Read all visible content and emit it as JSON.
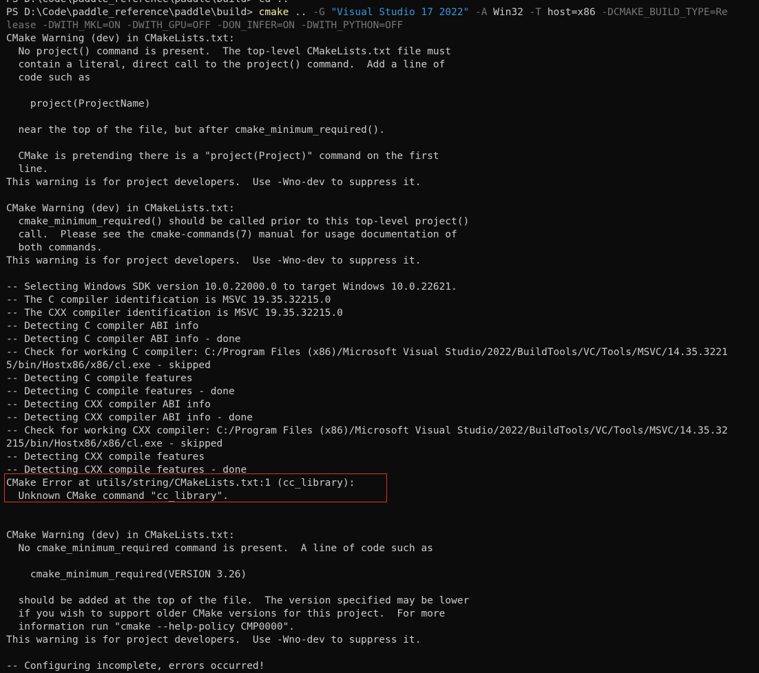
{
  "terminal": {
    "partial_prompt_line": "PS D:\\Code\\paddle_reference\\paddle\\build> cd ..",
    "prompt": "PS D:\\Code\\paddle_reference\\paddle\\build> ",
    "command": {
      "name": "cmake",
      "seg1": " .. ",
      "flag_G": "-G",
      "sp1": " ",
      "generator": "\"Visual Studio 17 2022\"",
      "sp2": " ",
      "flag_A": "-A",
      "arch": " Win32 ",
      "flag_T": "-T",
      "toolset": " host=x86 ",
      "defs_line1": "-DCMAKE_BUILD_TYPE=Re",
      "defs_line2": "lease -DWITH_MKL=ON -DWITH_GPU=OFF -DON_INFER=ON -DWITH_PYTHON=OFF"
    },
    "lines_before_error": [
      "CMake Warning (dev) in CMakeLists.txt:",
      "  No project() command is present.  The top-level CMakeLists.txt file must",
      "  contain a literal, direct call to the project() command.  Add a line of",
      "  code such as",
      "",
      "    project(ProjectName)",
      "",
      "  near the top of the file, but after cmake_minimum_required().",
      "",
      "  CMake is pretending there is a \"project(Project)\" command on the first",
      "  line.",
      "This warning is for project developers.  Use -Wno-dev to suppress it.",
      "",
      "CMake Warning (dev) in CMakeLists.txt:",
      "  cmake_minimum_required() should be called prior to this top-level project()",
      "  call.  Please see the cmake-commands(7) manual for usage documentation of",
      "  both commands.",
      "This warning is for project developers.  Use -Wno-dev to suppress it.",
      "",
      "-- Selecting Windows SDK version 10.0.22000.0 to target Windows 10.0.22621.",
      "-- The C compiler identification is MSVC 19.35.32215.0",
      "-- The CXX compiler identification is MSVC 19.35.32215.0",
      "-- Detecting C compiler ABI info",
      "-- Detecting C compiler ABI info - done",
      "-- Check for working C compiler: C:/Program Files (x86)/Microsoft Visual Studio/2022/BuildTools/VC/Tools/MSVC/14.35.3221",
      "5/bin/Hostx86/x86/cl.exe - skipped",
      "-- Detecting C compile features",
      "-- Detecting C compile features - done",
      "-- Detecting CXX compiler ABI info",
      "-- Detecting CXX compiler ABI info - done",
      "-- Check for working CXX compiler: C:/Program Files (x86)/Microsoft Visual Studio/2022/BuildTools/VC/Tools/MSVC/14.35.32",
      "215/bin/Hostx86/x86/cl.exe - skipped",
      "-- Detecting CXX compile features",
      "-- Detecting CXX compile features - done"
    ],
    "error_lines": [
      "CMake Error at utils/string/CMakeLists.txt:1 (cc_library):",
      "  Unknown CMake command \"cc_library\"."
    ],
    "lines_after_error": [
      "",
      "",
      "CMake Warning (dev) in CMakeLists.txt:",
      "  No cmake_minimum_required command is present.  A line of code such as",
      "",
      "    cmake_minimum_required(VERSION 3.26)",
      "",
      "  should be added at the top of the file.  The version specified may be lower",
      "  if you wish to support older CMake versions for this project.  For more",
      "  information run \"cmake --help-policy CMP0000\".",
      "This warning is for project developers.  Use -Wno-dev to suppress it.",
      "",
      "-- Configuring incomplete, errors occurred!"
    ]
  },
  "colors": {
    "background": "#0c0c0c",
    "text": "#cccccc",
    "command": "#f9f1a5",
    "flag": "#767676",
    "string": "#3a96dd",
    "highlight_border": "#e03030"
  }
}
